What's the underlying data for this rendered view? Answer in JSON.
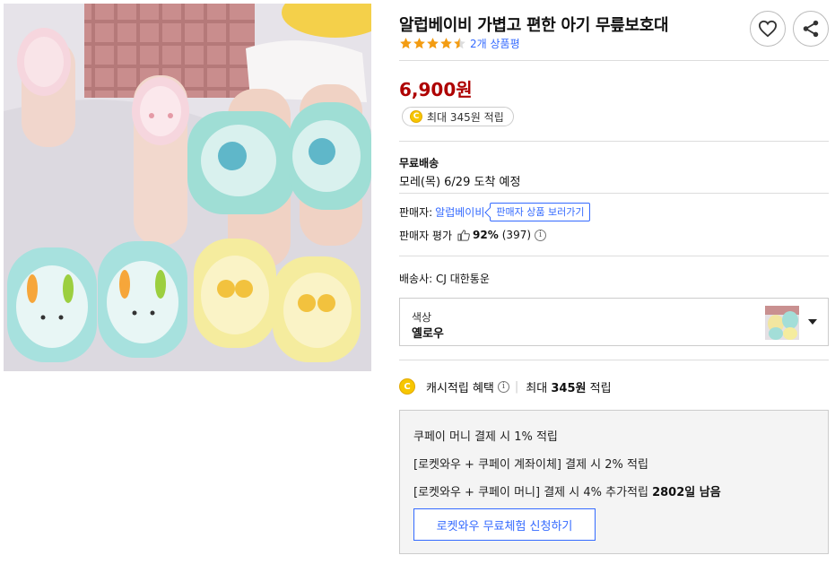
{
  "product": {
    "title": "알럽베이비 가볍고 편한 아기 무릎보호대",
    "rating": 4.5,
    "review_count": "2개 상품평",
    "price": "6,900원",
    "cash_badge": "최대 345원 적립"
  },
  "actions": {
    "heart_icon": "heart-icon",
    "share_icon": "share-icon"
  },
  "shipping": {
    "label": "무료배송",
    "eta": "모레(목) 6/29 도착 예정"
  },
  "seller": {
    "prefix": "판매자:",
    "name": "알럽베이비",
    "view_button": "판매자 상품 보러가기",
    "score_label": "판매자 평가",
    "score_percent": "92%",
    "score_count": "(397)"
  },
  "carrier": "배송사: CJ 대한통운",
  "option": {
    "label": "색상",
    "value": "옐로우"
  },
  "cash_benefit": {
    "coin": "C",
    "label": "캐시적립 혜택",
    "separator": "|",
    "max_prefix": "최대",
    "max_amount": "345원",
    "max_suffix": "적립",
    "lines": [
      "쿠페이 머니 결제 시 1% 적립",
      "[로켓와우 + 쿠페이 계좌이체] 결제 시 2% 적립",
      "[로켓와우 + 쿠페이 머니] 결제 시 4% 추가적립"
    ],
    "days_left": "2802일 남음",
    "trial_button": "로켓와우 무료체험 신청하기"
  },
  "colors": {
    "price_red": "#ae0000",
    "link_blue": "#346aff",
    "star_orange": "#f39c12",
    "coin_yellow": "#f7c600"
  }
}
